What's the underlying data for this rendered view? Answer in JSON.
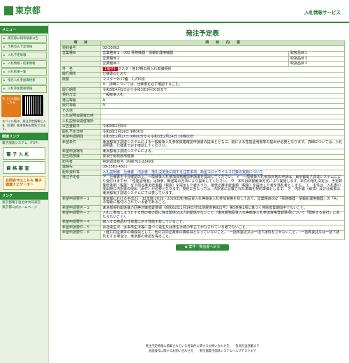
{
  "header": {
    "logo_text": "東京都",
    "service_title": "入札情報サービス"
  },
  "sidebar": {
    "menu_heading": "メニュー",
    "items": [
      "東京都公報等検索公告",
      "予算見込予定情報",
      "入札予定情報",
      "入札情報・結果情報",
      "入札結果一覧",
      "指名入札参加資格者",
      "入札参加資格情報"
    ],
    "mobile_label": "モバイル版はこちら",
    "mobile_note": "モバイル版は、発注予定情報と入札（見積）結果情報を閲覧できます。",
    "links_heading": "関連リンク",
    "links": [
      "電子調達システム（TOP）"
    ],
    "big_links": [
      "電 子 入 札",
      "資 格 審 査"
    ],
    "contact": "お問合せはこちら 電子調達ナビゲーター",
    "links2_heading": "リンク",
    "links2": [
      "東京都電子自治体共同運営",
      "東京都公式ホームページ"
    ]
  },
  "main": {
    "title": "発注予定表",
    "col_item": "項　　目",
    "col_content": "項　　目　　内　　容",
    "rows": [
      {
        "label": "契約番号",
        "value": "02-20002"
      },
      {
        "label": "営業種目",
        "value": "営業種目１ : 002 事務機器・情報処理用機器",
        "extra": "取扱品目１"
      },
      {
        "label": "",
        "value": "営業種目２",
        "extra": "取扱品目２"
      },
      {
        "label": "",
        "value": "営業種目３",
        "extra": "取扱品目３"
      },
      {
        "label": "件　名",
        "tag": "【電子】",
        "value": "マスター各17種の買入れ単価契約"
      },
      {
        "label": "履行場所",
        "value": "仕様書のとおり"
      },
      {
        "label": "概要",
        "value": "マスター外17種　1,230点"
      },
      {
        "label": "",
        "value": "※　詳細については、仕様書を必ず確認すること。"
      },
      {
        "label": "履行期限",
        "value": "令和3年4月1日から令和3年9月30日まで"
      },
      {
        "label": "契約方法",
        "value": "一般競争入札"
      },
      {
        "label": "発注等級",
        "value": "A"
      },
      {
        "label": "受付等級",
        "value": "A"
      },
      {
        "label": "その他",
        "value": ""
      },
      {
        "label": "入札説明会開催日時",
        "value": ""
      },
      {
        "label": "入札説明会開催場所",
        "value": ""
      },
      {
        "label": "公告登載日",
        "value": "令和3年2月5日"
      },
      {
        "label": "開札予定日時",
        "value": "令和3年3月19日 9時30分"
      },
      {
        "label": "希望申請期間",
        "value": "令和3年2月17日 9時00分から令和3年2月24日 16時00分"
      },
      {
        "label": "希望条件",
        "value": "東京都電子調達システムによる一般競争入札参加資格確認申請書の提出とともに、紙による性能証明書等の提出が必要となります。詳細については、入札説明書、仕様書で必ず確認してください。"
      },
      {
        "label": "希望申請場所",
        "value": "東京都電子調達システムによる。"
      },
      {
        "label": "担当局部課",
        "value": "警視庁総務部用度課"
      },
      {
        "label": "担当者",
        "value": "特定調達担当（内線702-22493）"
      },
      {
        "label": "連絡先",
        "value": "03-3581-4321"
      },
      {
        "label": "配布資料等",
        "value": "入札説明書　仕様書　内訳書　落札決定後に関する注意事項　新型コロナウイルス対策の実施について"
      },
      {
        "label": "発注予定者",
        "value": "ア　仕様書を十分確認の上、一般競争入札参加資格確認申請書を提出してください。 イ　一般競争入札参加資格の申請は、東京都電子調達システムにより受付けますが、「性能証明書」は持参、郵送等の方法により提出してください。 ウ　本件は総額競争方式により実施します。本件の落札決定は、予定数量総金額（税抜）を下回る推定総金額（税抜）を提示した者のうち、最低の推定総金額（税抜）を提示した者を落札者とします。 エ　本件は、入札書の提出時に内訳書の提出（添付）が必要となります。契約に当たっては、内訳書に記載された単価を契約単価とします。 オ　内訳書（様式）及び仕様書は東京都電子調達システムにて公表しています。"
      },
      {
        "label": "希望申請要件－１",
        "value": "東京都における平成31・32年度(2019・2020年度)物品買入れ等競争入札参加資格を有しており、営業種目002「事務機器・情報処理用機器」の「A」の等級に格付けされている者であること。"
      },
      {
        "label": "希望申請要件－２",
        "value": "東京都契約関係暴力団等対策措置要綱（昭和62年1月14日付61財経庶第922号）第5条第1項に基づく排除措置期間中でないこと。"
      },
      {
        "label": "希望申請要件－３",
        "value": "入札に参加しようとする他の者の間に資本関係又は人的関係がないこと（東京都物品買入れ等競争入札参加資格登録事項について「関係する会社」にあたらないこと）。"
      },
      {
        "label": "希望申請要件－４",
        "value": "納入する物品が仕様書に示す性能を有していること。"
      },
      {
        "label": "希望申請要件－５",
        "value": "会社更生法、民事再生法等に基づく更生又は再生手続の申立てがなされている者でないこと。"
      },
      {
        "label": "希望申請要件－６",
        "value": "・経共同企業体の構成員として、他の共同企業体の構成員となっていないこと。・一括再委託又は一括下請負をさせないこと。・一括再委託又は一括下請負をする場合は、東京都の承認を得ること。"
      }
    ],
    "back_button": "◆ 案件一覧画面へ戻る"
  },
  "footer": {
    "line1": "発注予定情報に掲載されている各案件に関するお問い合わせ先　　各局担当部署まで",
    "line2": "画面操作に関するお問い合わせ先　　東京都電子調達システムヘルプデスクまで"
  }
}
